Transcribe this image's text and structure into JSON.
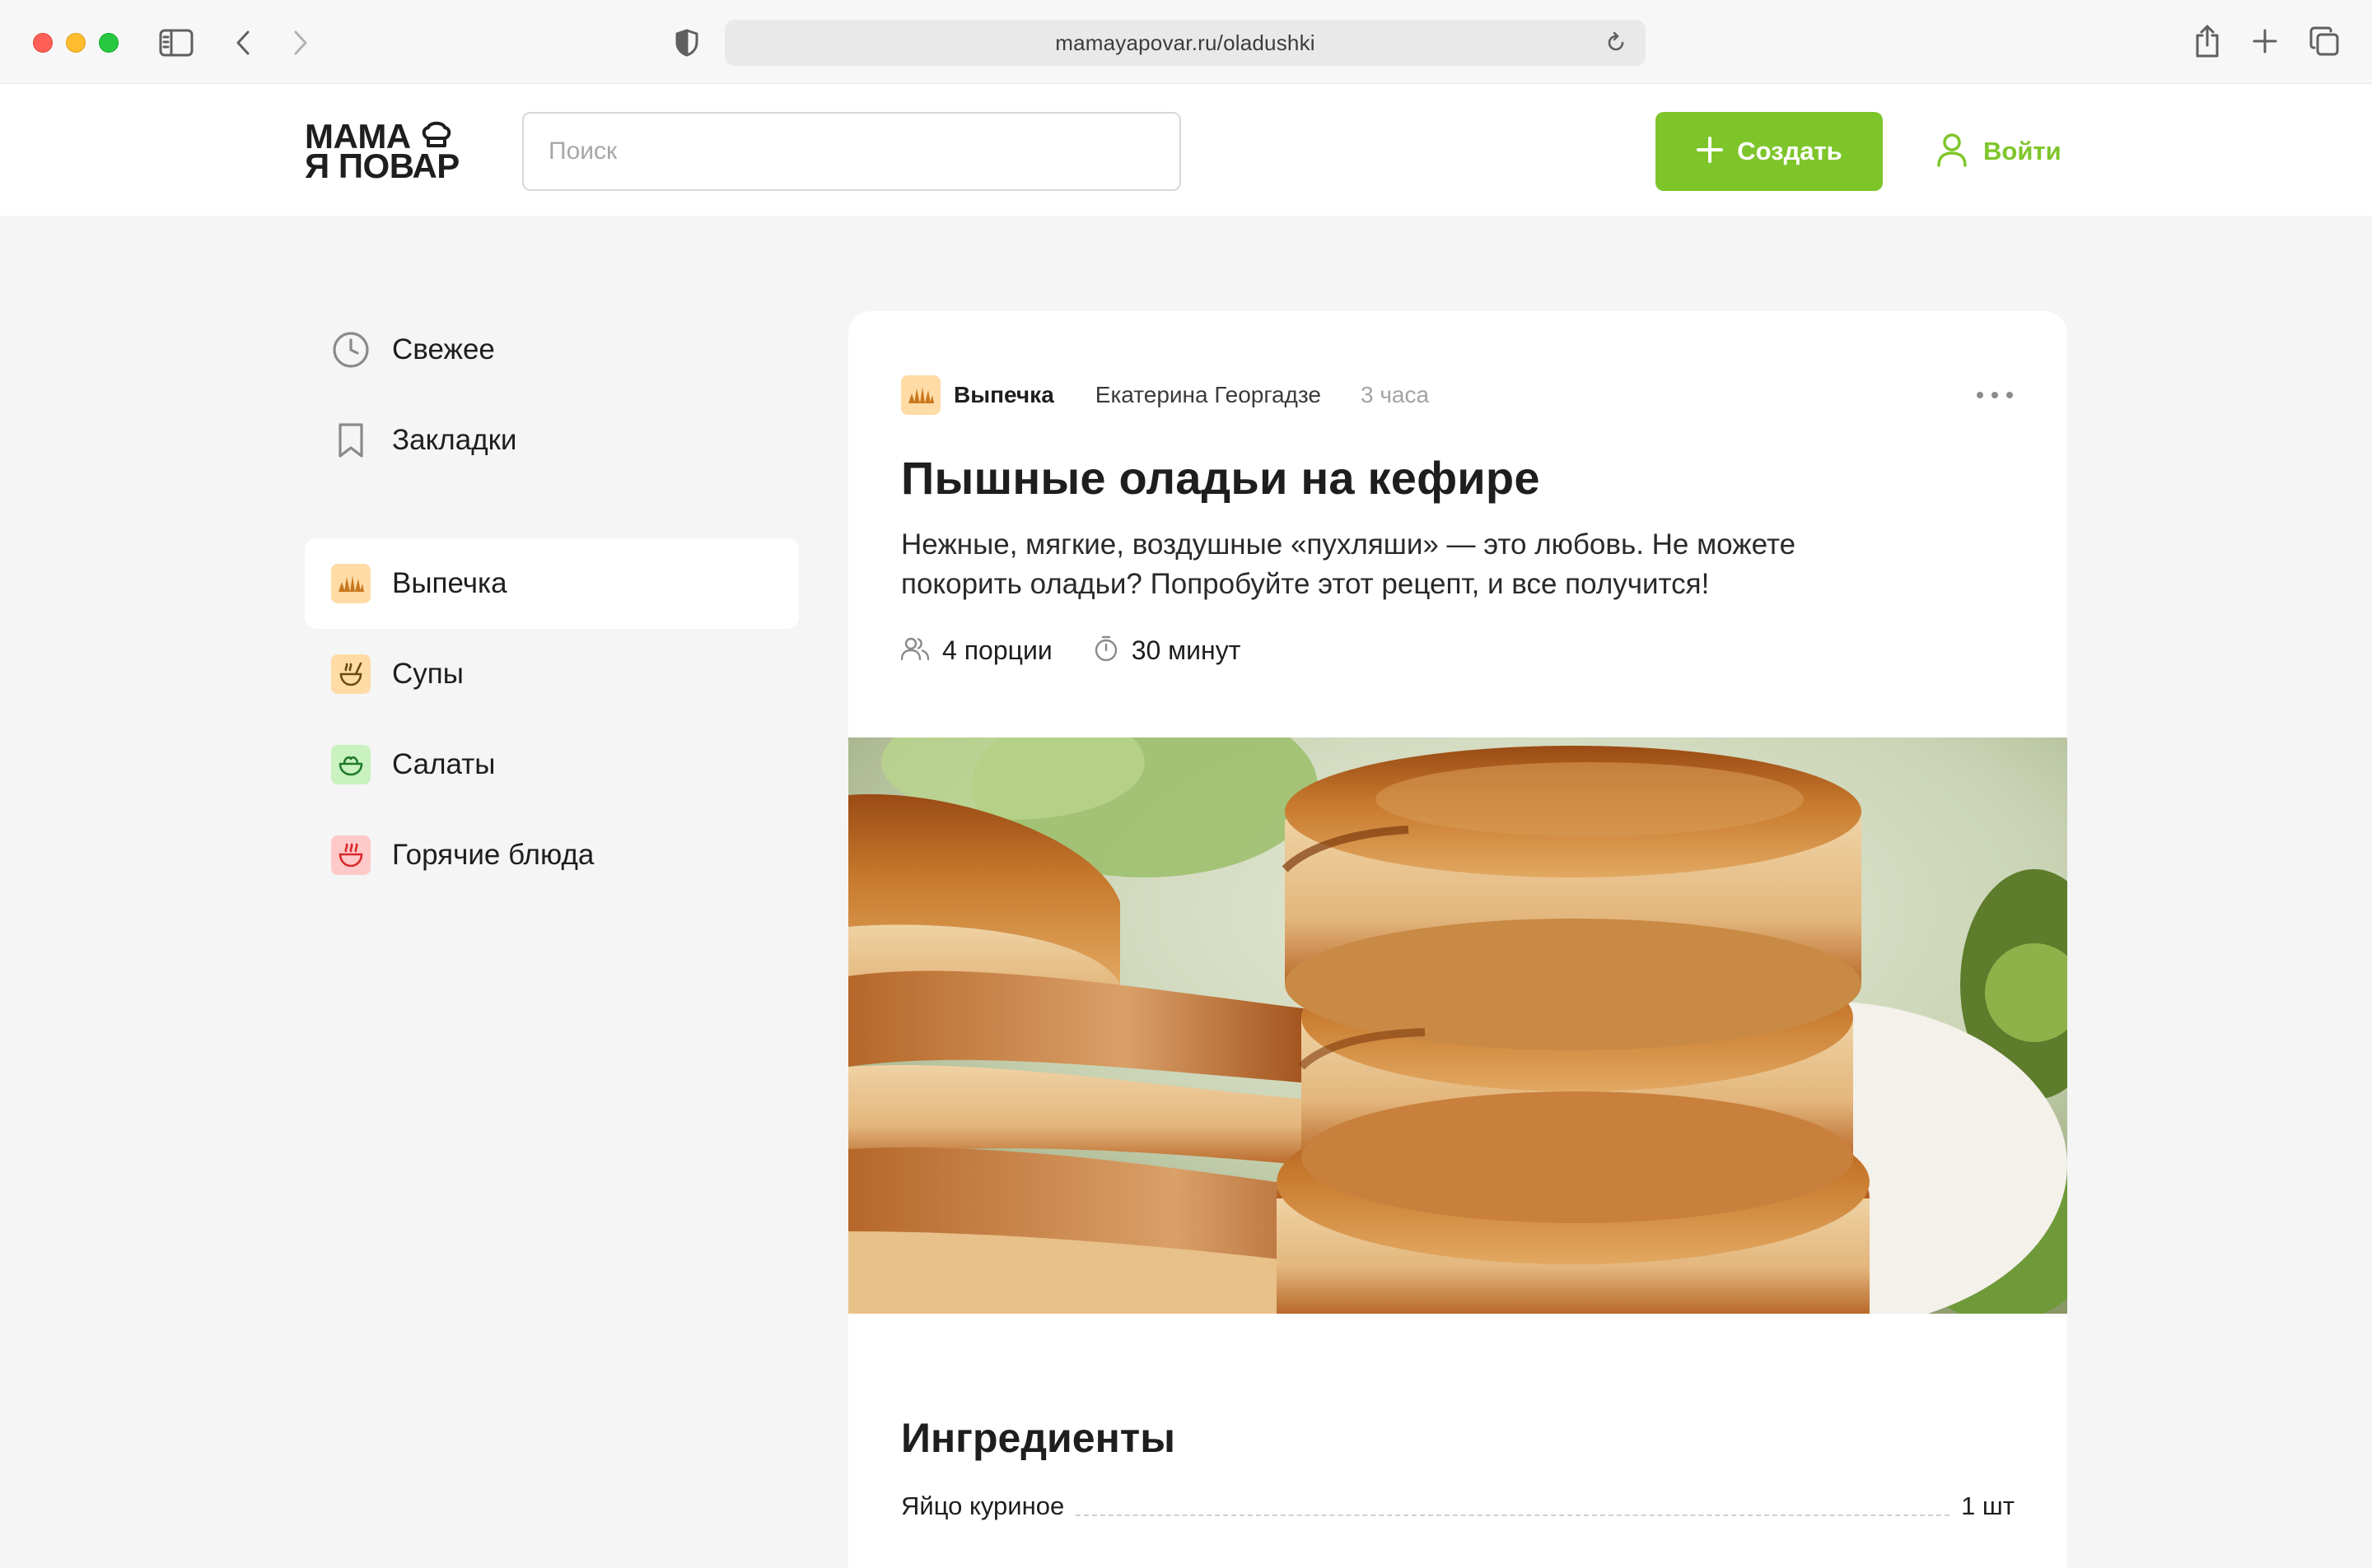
{
  "browser": {
    "url": "mamayapovar.ru/oladushki"
  },
  "header": {
    "logo_line1": "МАМА",
    "logo_line2": "Я ПОВАР",
    "search_placeholder": "Поиск",
    "create_label": "Создать",
    "login_label": "Войти",
    "accent_color": "#7ec52a"
  },
  "sidebar": {
    "items": [
      {
        "label": "Свежее",
        "icon": "clock-icon"
      },
      {
        "label": "Закладки",
        "icon": "bookmark-icon"
      },
      {
        "label": "Выпечка",
        "icon": "croissant-icon",
        "active": true
      },
      {
        "label": "Супы",
        "icon": "soup-icon"
      },
      {
        "label": "Салаты",
        "icon": "salad-icon"
      },
      {
        "label": "Горячие блюда",
        "icon": "hot-dish-icon"
      }
    ]
  },
  "post": {
    "category": "Выпечка",
    "author": "Екатерина Георгадзе",
    "time": "3 часа",
    "title": "Пышные оладьи на кефире",
    "description": "Нежные, мягкие, воздушные «пухляши» — это любовь. Не можете покорить оладьи? Попробуйте этот рецепт, и все получится!",
    "servings": "4 порции",
    "duration": "30 минут",
    "ingredients_title": "Ингредиенты",
    "ingredients": [
      {
        "name": "Яйцо куриное",
        "qty": "1 шт"
      }
    ]
  }
}
